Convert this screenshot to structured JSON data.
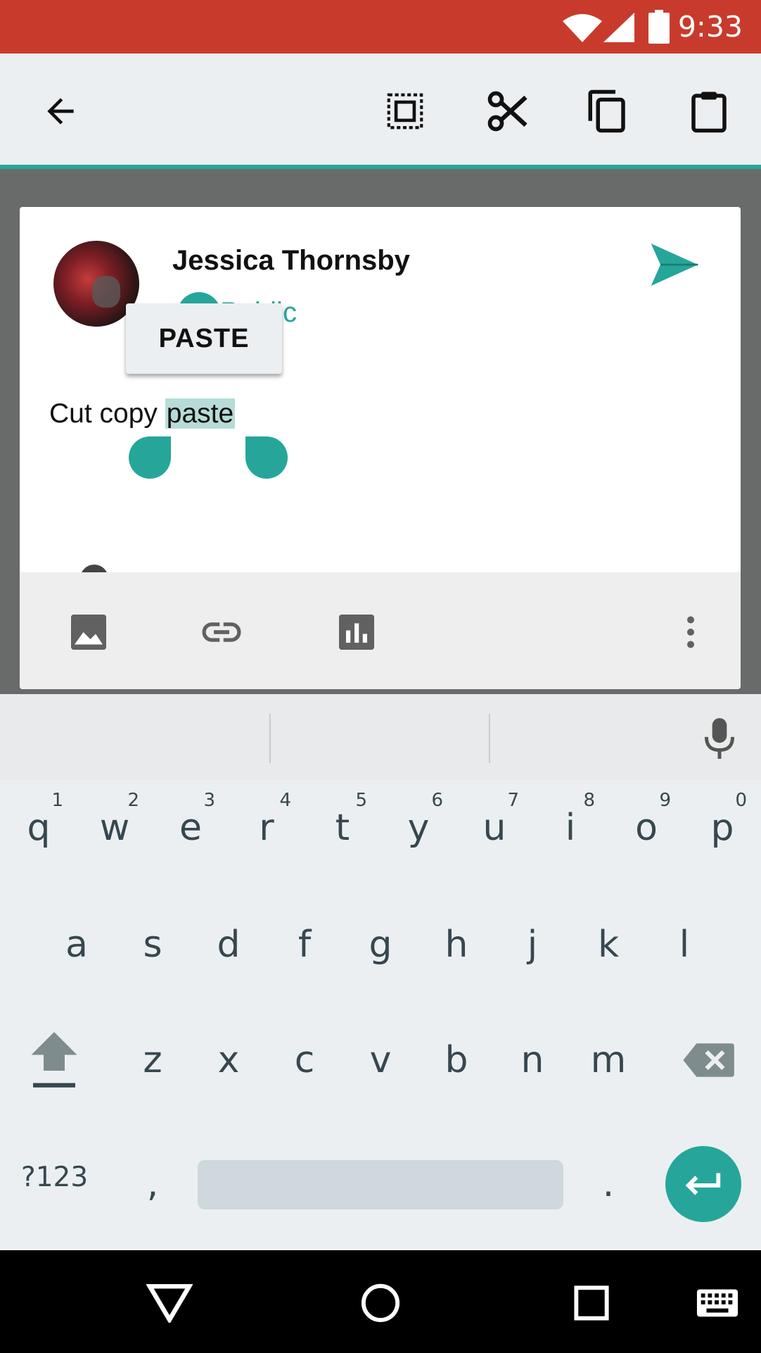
{
  "status_bar": {
    "time": "9:33",
    "bg": "#c83b2c"
  },
  "action_bar": {
    "back_icon": "arrow-left-icon",
    "actions": [
      {
        "name": "select-all-icon"
      },
      {
        "name": "cut-icon"
      },
      {
        "name": "copy-icon"
      },
      {
        "name": "paste-icon"
      }
    ]
  },
  "post": {
    "author": "Jessica Thornsby",
    "audience": "Public",
    "text_plain": "Cut copy ",
    "text_selected": "paste",
    "popup_label": "PASTE"
  },
  "card_toolbar": {
    "items": [
      "image-icon",
      "link-icon",
      "poll-icon",
      "more-vert-icon"
    ]
  },
  "keyboard": {
    "row1": [
      {
        "label": "q",
        "hint": "1"
      },
      {
        "label": "w",
        "hint": "2"
      },
      {
        "label": "e",
        "hint": "3"
      },
      {
        "label": "r",
        "hint": "4"
      },
      {
        "label": "t",
        "hint": "5"
      },
      {
        "label": "y",
        "hint": "6"
      },
      {
        "label": "u",
        "hint": "7"
      },
      {
        "label": "i",
        "hint": "8"
      },
      {
        "label": "o",
        "hint": "9"
      },
      {
        "label": "p",
        "hint": "0"
      }
    ],
    "row2": [
      "a",
      "s",
      "d",
      "f",
      "g",
      "h",
      "j",
      "k",
      "l"
    ],
    "row3": [
      "z",
      "x",
      "c",
      "v",
      "b",
      "n",
      "m"
    ],
    "symbols_label": "?123",
    "comma": ",",
    "period": "."
  },
  "colors": {
    "accent": "#26a69a",
    "keyboard_bg": "#eceff1",
    "key_text": "#37474f"
  }
}
